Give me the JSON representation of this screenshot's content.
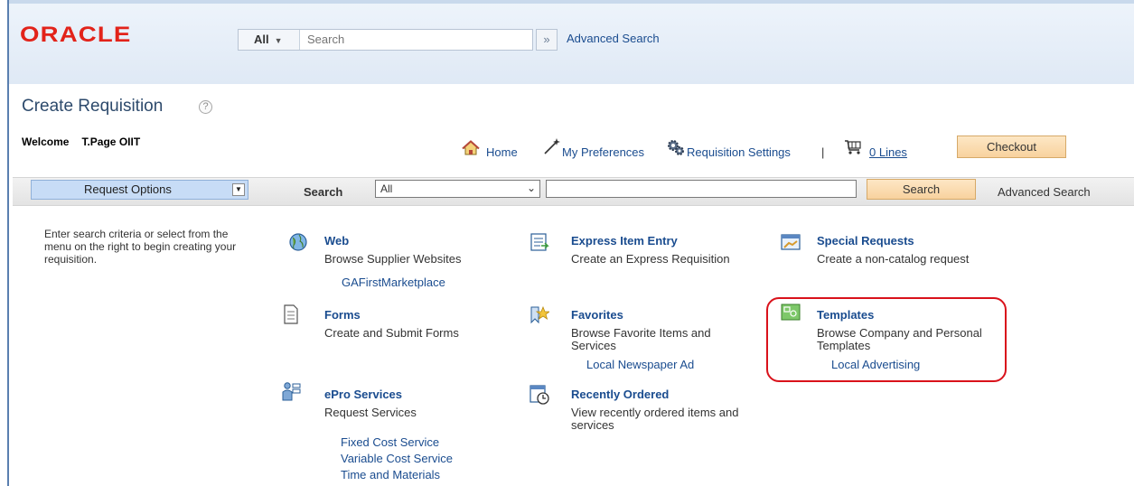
{
  "header": {
    "logo": "ORACLE",
    "search_scope": "All",
    "search_placeholder": "Search",
    "go_symbol": "»",
    "advanced_search": "Advanced Search"
  },
  "page": {
    "title": "Create Requisition",
    "help_symbol": "?",
    "welcome_label": "Welcome",
    "user_name": "T.Page OIIT"
  },
  "nav": {
    "home": "Home",
    "my_preferences": "My Preferences",
    "requisition_settings": "Requisition Settings",
    "separator": "|",
    "lines": "0 Lines",
    "checkout": "Checkout"
  },
  "search_band": {
    "request_options": "Request Options",
    "search_label": "Search",
    "select_value": "All",
    "input_value": "",
    "search_button": "Search",
    "advanced_search": "Advanced Search"
  },
  "instructions": "Enter search criteria or select from the menu on the right to begin creating your requisition.",
  "tiles": {
    "web": {
      "title": "Web",
      "desc": "Browse Supplier Websites",
      "links": [
        "GAFirstMarketplace"
      ]
    },
    "express": {
      "title": "Express Item Entry",
      "desc": "Create an Express Requisition"
    },
    "special": {
      "title": "Special Requests",
      "desc": "Create a non-catalog request"
    },
    "forms": {
      "title": "Forms",
      "desc": "Create and Submit Forms"
    },
    "favorites": {
      "title": "Favorites",
      "desc": "Browse Favorite Items and Services",
      "links": [
        "Local Newspaper Ad"
      ]
    },
    "templates": {
      "title": "Templates",
      "desc": "Browse Company and Personal Templates",
      "links": [
        "Local Advertising"
      ]
    },
    "epro": {
      "title": "ePro Services",
      "desc": "Request Services",
      "links": [
        "Fixed Cost Service",
        "Variable Cost Service",
        "Time and Materials"
      ]
    },
    "recent": {
      "title": "Recently Ordered",
      "desc": "View recently ordered items and services"
    }
  },
  "colors": {
    "link": "#1a4c8f",
    "brand_red": "#e2231a",
    "highlight": "#d9121b",
    "button": "#f8d29e"
  }
}
